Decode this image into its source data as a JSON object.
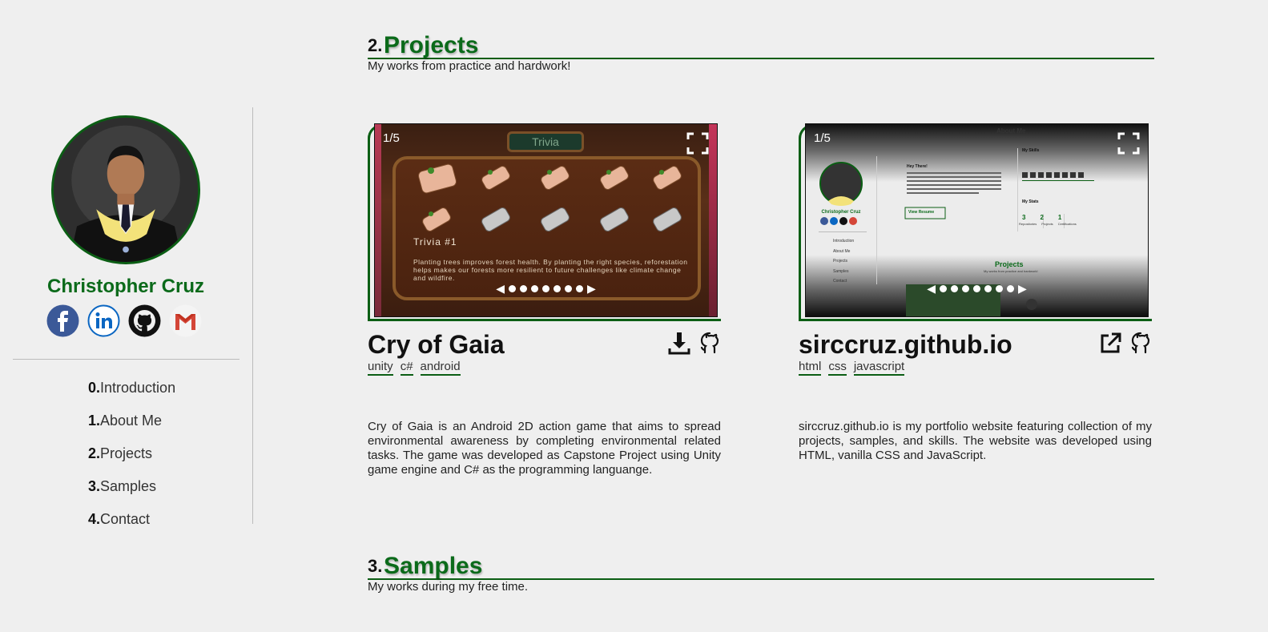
{
  "sidebar": {
    "name": "Christopher Cruz",
    "socials": [
      "facebook-icon",
      "linkedin-icon",
      "github-icon",
      "gmail-icon"
    ],
    "nav": [
      {
        "num": "0.",
        "label": "Introduction"
      },
      {
        "num": "1.",
        "label": "About Me"
      },
      {
        "num": "2.",
        "label": "Projects"
      },
      {
        "num": "3.",
        "label": "Samples"
      },
      {
        "num": "4.",
        "label": "Contact"
      }
    ]
  },
  "projects_section": {
    "num": "2.",
    "title": "Projects",
    "subtitle": "My works from practice and hardwork!"
  },
  "samples_section": {
    "num": "3.",
    "title": "Samples",
    "subtitle": "My works during my free time."
  },
  "projects": [
    {
      "title": "Cry of Gaia",
      "counter": "1/5",
      "tags": [
        "unity",
        "c#",
        "android"
      ],
      "icons": [
        "download-icon",
        "github-icon"
      ],
      "slide": {
        "tab": "Trivia",
        "heading": "Trivia #1",
        "text": "Planting trees improves forest health. By planting the right species, reforestation helps makes our forests more resilient to future challenges like climate change and wildfire."
      },
      "description": "Cry of Gaia is an Android 2D action game that aims to spread environmental awareness by completing environmental related tasks. The game was developed as Capstone Project using Unity game engine and C# as the programming languange."
    },
    {
      "title": "sirccruz.github.io",
      "counter": "1/5",
      "tags": [
        "html",
        "css",
        "javascript"
      ],
      "icons": [
        "external-link-icon",
        "github-icon"
      ],
      "slide": {
        "about": "About Me",
        "greeting": "Hey There!",
        "name": "Christopher Cruz",
        "button": "View Resume",
        "skills": "My Skills",
        "stats": "My Stats",
        "stat_values": [
          "3",
          "2",
          "1"
        ],
        "stat_labels": [
          "Repositories",
          "Projects",
          "Certifications"
        ],
        "nav": [
          "Introduction",
          "About Me",
          "Projects",
          "Samples",
          "Contact"
        ],
        "projects": "Projects",
        "projects_sub": "My works from practice and hardwork!"
      },
      "description": "sirccruz.github.io is my portfolio website featuring collection of my projects, samples, and skills. The website was developed using HTML, vanilla CSS and JavaScript."
    }
  ],
  "colors": {
    "accent": "#0b6a1a",
    "background": "#efefef"
  }
}
